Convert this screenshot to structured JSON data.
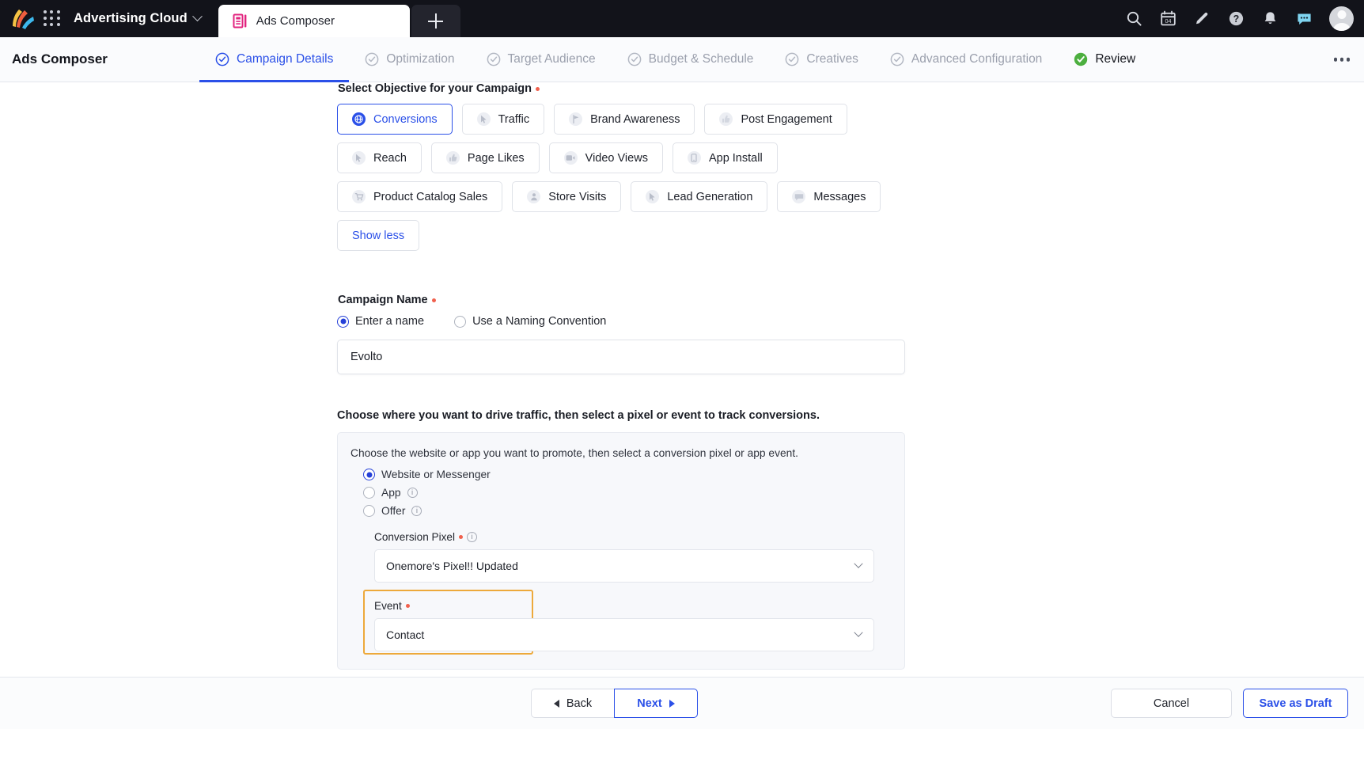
{
  "topbar": {
    "logo": "yahoo-logo",
    "apps_grid_icon": "apps-grid-icon",
    "product": "Advertising Cloud",
    "tab": {
      "label": "Ads Composer",
      "icon": "ads-composer-icon"
    },
    "add_tab_icon": "plus-icon",
    "icons": [
      "search-icon",
      "calendar-icon",
      "pencil-icon",
      "help-icon",
      "bell-icon",
      "chat-icon",
      "avatar"
    ],
    "calendar_day": "04"
  },
  "subheader": {
    "title": "Ads Composer",
    "tabs": [
      {
        "label": "Campaign Details",
        "state": "active"
      },
      {
        "label": "Optimization",
        "state": "pending"
      },
      {
        "label": "Target Audience",
        "state": "pending"
      },
      {
        "label": "Budget & Schedule",
        "state": "pending"
      },
      {
        "label": "Creatives",
        "state": "pending"
      },
      {
        "label": "Advanced Configuration",
        "state": "pending"
      },
      {
        "label": "Review",
        "state": "done"
      }
    ],
    "overflow_icon": "more-options-icon"
  },
  "objective": {
    "label": "Select Objective for your Campaign",
    "required": true,
    "selected": "Conversions",
    "rows": [
      [
        {
          "label": "Conversions",
          "icon": "globe-icon",
          "selected": true
        },
        {
          "label": "Traffic",
          "icon": "cursor-icon",
          "selected": false
        },
        {
          "label": "Brand Awareness",
          "icon": "flag-icon",
          "selected": false
        },
        {
          "label": "Post Engagement",
          "icon": "thumb-icon",
          "selected": false
        }
      ],
      [
        {
          "label": "Reach",
          "icon": "cursor-icon",
          "selected": false
        },
        {
          "label": "Page Likes",
          "icon": "thumb-up-icon",
          "selected": false
        },
        {
          "label": "Video Views",
          "icon": "video-icon",
          "selected": false
        },
        {
          "label": "App Install",
          "icon": "app-icon",
          "selected": false
        }
      ],
      [
        {
          "label": "Product Catalog Sales",
          "icon": "cart-icon",
          "selected": false
        },
        {
          "label": "Store Visits",
          "icon": "person-pin-icon",
          "selected": false
        },
        {
          "label": "Lead Generation",
          "icon": "cursor-icon",
          "selected": false
        },
        {
          "label": "Messages",
          "icon": "message-icon",
          "selected": false
        }
      ]
    ],
    "show_less": "Show less"
  },
  "campaign_name": {
    "label": "Campaign Name",
    "required": true,
    "options": [
      {
        "label": "Enter a name",
        "selected": true
      },
      {
        "label": "Use a Naming Convention",
        "selected": false
      }
    ],
    "value": "Evolto"
  },
  "traffic": {
    "heading": "Choose where you want to drive traffic, then select a pixel or event to track conversions.",
    "panel_lead": "Choose the website or app you want to promote, then select a conversion pixel or app event.",
    "destinations": [
      {
        "label": "Website or Messenger",
        "selected": true,
        "info": false
      },
      {
        "label": "App",
        "selected": false,
        "info": true
      },
      {
        "label": "Offer",
        "selected": false,
        "info": true
      }
    ],
    "conversion_pixel": {
      "label": "Conversion Pixel",
      "required": true,
      "info": true,
      "value": "Onemore's Pixel!! Updated"
    },
    "event": {
      "label": "Event",
      "required": true,
      "value": "Contact",
      "highlighted": true,
      "highlight_color": "#eda93b"
    }
  },
  "footer": {
    "back": "Back",
    "next": "Next",
    "cancel": "Cancel",
    "save_draft": "Save as Draft"
  },
  "colors": {
    "accent_blue": "#2b50e8",
    "topbar_bg": "#12131a",
    "success_green": "#4caf3f",
    "required_red": "#f0604d",
    "highlight_orange": "#eda93b"
  }
}
